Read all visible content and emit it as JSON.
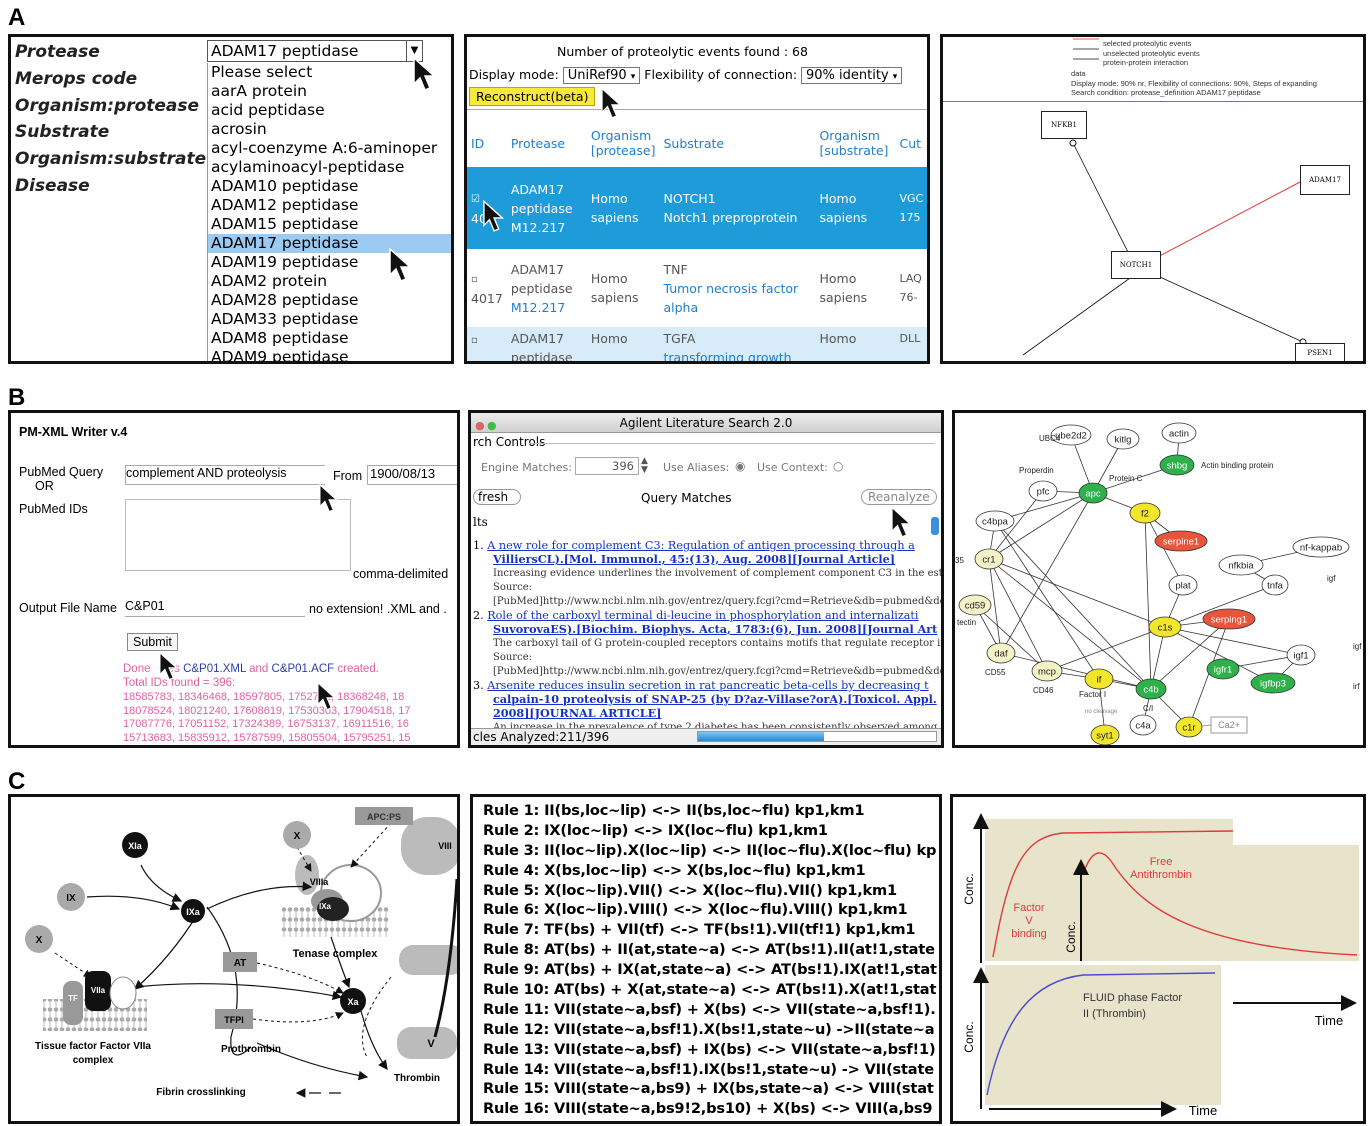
{
  "panel_labels": {
    "a": "A",
    "b": "B",
    "c": "C"
  },
  "a1": {
    "labels": [
      "Protease",
      "Merops code",
      "Organism:protease",
      "Substrate",
      "Organism:substrate",
      "Disease"
    ],
    "selected": "ADAM17 peptidase",
    "options": [
      "Please select",
      "aarA protein",
      "acid peptidase",
      "acrosin",
      "acyl-coenzyme A:6-aminoper",
      "acylaminoacyl-peptidase",
      "ADAM10 peptidase",
      "ADAM12 peptidase",
      "ADAM15 peptidase",
      "ADAM17 peptidase",
      "ADAM19 peptidase",
      "ADAM2 protein",
      "ADAM28 peptidase",
      "ADAM33 peptidase",
      "ADAM8 peptidase",
      "ADAM9 peptidase"
    ],
    "highlight_index": 9
  },
  "a2": {
    "events_found": "Number of proteolytic events found : 68",
    "display_mode_label": "Display mode:",
    "display_mode_value": "UniRef90",
    "flex_label": "Flexibility of connection:",
    "flex_value": "90% identity",
    "reconstruct_button": "Reconstruct(beta)",
    "headers": {
      "id": "ID",
      "protease": "Protease",
      "org_protease": "Organism [protease]",
      "substrate": "Substrate",
      "org_substrate": "Organism [substrate]",
      "cut": "Cut"
    },
    "rows": [
      {
        "id": "40",
        "protease": "ADAM17 peptidase",
        "merops": "M12.217",
        "org_p": "Homo sapiens",
        "sub": "NOTCH1",
        "sub_desc": "Notch1 preproprotein",
        "org_s": "Homo sapiens",
        "cut": "VGC 175"
      },
      {
        "id": "4017",
        "protease": "ADAM17 peptidase",
        "merops": "M12.217",
        "org_p": "Homo sapiens",
        "sub": "TNF",
        "sub_desc": "Tumor necrosis factor alpha",
        "org_s": "Homo sapiens",
        "cut": "LAQ 76-"
      },
      {
        "id": "",
        "protease": "ADAM17 peptidase",
        "merops": "",
        "org_p": "Homo",
        "sub": "TGFA",
        "sub_desc": "transforming growth",
        "org_s": "Homo",
        "cut": "DLL"
      }
    ]
  },
  "a3": {
    "legend": [
      "selected proteolytic events",
      "unselected proteolytic events",
      "protein-protein interaction",
      "data",
      "Display mode: 90% nr, Flexibility of connections: 90%, Steps of expanding",
      "Search condition: protease_definition ADAM17 peptidase"
    ],
    "nodes": {
      "nfkb1": "NFKB1",
      "adam17": "ADAM17",
      "notch1": "NOTCH1",
      "psen1": "PSEN1"
    }
  },
  "b1": {
    "title": "PM-XML Writer v.4",
    "query_label": "PubMed Query",
    "or_label": "OR",
    "ids_label": "PubMed IDs",
    "query_value": "complement AND proteolysis",
    "from_label": "From",
    "from_value": "1900/08/13",
    "comma_note": "comma-delimited",
    "output_label": "Output File Name",
    "output_value": "C&P01",
    "ext_note": "no extension! .XML and .",
    "submit": "Submit",
    "done_prefix": "Done",
    "done_fragment": "es",
    "file1": "C&P01.XML",
    "and_word": "and",
    "file2": "C&P01.ACF",
    "created": "created.",
    "total": "Total IDs found = 396:",
    "id_lines": [
      "18585783, 18346468, 18597805, 1752712, 18368248, 18",
      "18078524, 18021240, 17608619, 17530303, 17904518, 17",
      "17087776, 17051152, 17324389, 16753137, 16911516, 16",
      "15713683, 15835912, 15787599, 15805504, 15795251, 15"
    ]
  },
  "b2": {
    "title": "Agilent Literature Search 2.0",
    "controls": "rch Controls",
    "engine_label": "Engine Matches:",
    "engine_value": "396",
    "aliases": "Use Aliases:",
    "context": "Use Context:",
    "refresh": "fresh",
    "query_matches": "Query Matches",
    "reanalyze": "Reanalyze",
    "results_label": "lts",
    "results": [
      {
        "num": "1.",
        "title": "A new role for complement C3: Regulation of antigen processing through a",
        "cite": "VilliersCL).[Mol. Immunol., 45:(13), Aug. 2008][Journal Article]",
        "abstract": "Increasing evidence underlines the involvement of complement component C3 in the establi",
        "src": "Source:",
        "url": "[PubMed]http://www.ncbi.nlm.nih.gov/entrez/query.fcgi?cmd=Retrieve&db=pubmed&dop"
      },
      {
        "num": "2.",
        "title": "Role of the carboxyl terminal di-leucine in phosphorylation and internalizati",
        "cite": "SuvorovaES).[Biochim. Biophys. Acta, 1783:(6), Jun. 2008][Journal Art",
        "abstract": "The carboxyl tail of G protein-coupled receptors contains motifs that regulate receptor interc",
        "src": "Source:",
        "url": "[PubMed]http://www.ncbi.nlm.nih.gov/entrez/query.fcgi?cmd=Retrieve&db=pubmed&dop"
      },
      {
        "num": "3.",
        "title": "Arsenite reduces insulin secretion in rat pancreatic beta-cells by decreasing t",
        "cite": "calpain-10 proteolysis of SNAP-25 (by D?az-Villase?orA).[Toxicol. Appl.",
        "cite2": "2008][JOURNAL ARTICLE]",
        "abstract": "An increase in the prevalence of type 2 diabetes has been consistently observed among resid"
      }
    ],
    "status": "cles Analyzed:211/396",
    "progress": 0.53
  },
  "b3": {
    "nodes": {
      "ube2d2": "ube2d2",
      "ubc4": "UBC4",
      "kitlg": "kitlg",
      "actin": "actin",
      "shbg": "shbg",
      "actin_bp": "Actin binding protein",
      "properdin": "Properdin",
      "pfc": "pfc",
      "apc": "apc",
      "proteinc": "Protein C",
      "f2": "f2",
      "c4bpa": "c4bpa",
      "cr1": "cr1",
      "serpine1": "serpine1",
      "nfkappab": "nf-kappab",
      "nfkbia": "nfkbia",
      "tnfa": "tnfa",
      "igf": "igf",
      "cd59": "cd59",
      "tectin": "tectin",
      "plat": "plat",
      "serping1": "serping1",
      "c1s": "c1s",
      "daf": "daf",
      "cd55": "CD55",
      "mcp": "mcp",
      "cd46": "CD46",
      "if": "if",
      "factori": "Factor I",
      "c4b": "c4b",
      "ci": "C/I",
      "igfr1": "igfr1",
      "igf1": "igf1",
      "igfbp3": "igfbp3",
      "igf2": "igf",
      "irf": "irf",
      "nocleavage": "no cleavage",
      "syt1": "syt1",
      "c4a": "c4a",
      "c1r": "c1r",
      "ca2": "Ca2+",
      "n35": "35"
    },
    "colors": {
      "green": "#2eb04a",
      "yellow": "#f2e62d",
      "red": "#e8553a",
      "pale": "#f3f1c6"
    }
  },
  "c1": {
    "apcps": "APC:PS",
    "xia": "XIa",
    "ix": "IX",
    "ixa": "IXa",
    "x1": "X",
    "x2": "X",
    "viii": "VIII",
    "viiia": "VIIIa",
    "ixa2": "IXa",
    "tenase": "Tenase complex",
    "at": "AT",
    "xa": "Xa",
    "tf": "TF",
    "viia": "VIIa",
    "tfpi": "TFPI",
    "v": "V",
    "tissue": "Tissue factor Factor VIIa",
    "complex": "complex",
    "prothrombin": "Prothrombin",
    "thrombin": "Thrombin",
    "fibrin": "Fibrin crosslinking"
  },
  "c2": {
    "rules": [
      "Rule 1: II(bs,loc~lip) <-> II(bs,loc~flu) kp1,km1",
      "Rule 2: IX(loc~lip) <-> IX(loc~flu) kp1,km1",
      "Rule 3: II(loc~lip).X(loc~lip) <-> II(loc~flu).X(loc~flu) kp",
      "Rule 4: X(bs,loc~lip) <-> X(bs,loc~flu) kp1,km1",
      "Rule 5: X(loc~lip).VII() <-> X(loc~flu).VII() kp1,km1",
      "Rule 6: X(loc~lip).VIII() <-> X(loc~flu).VIII() kp1,km1",
      "Rule 7: TF(bs) + VII(tf) <-> TF(bs!1).VII(tf!1) kp1,km1",
      "Rule 8: AT(bs) + II(at,state~a) <-> AT(bs!1).II(at!1,state",
      "Rule 9: AT(bs) + IX(at,state~a) <-> AT(bs!1).IX(at!1,stat",
      "Rule 10: AT(bs) + X(at,state~a) <-> AT(bs!1).X(at!1,stat",
      "Rule 11: VII(state~a,bsf) + X(bs) <-> VII(state~a,bsf!1).",
      "Rule 12: VII(state~a,bsf!1).X(bs!1,state~u) ->II(state~a",
      "Rule 13: VII(state~a,bsf) + IX(bs) <-> VII(state~a,bsf!1)",
      "Rule 14: VII(state~a,bsf!1).IX(bs!1,state~u) -> VII(state",
      "Rule 15: VIII(state~a,bs9) + IX(bs,state~a) <-> VIII(stat",
      "Rule 16: VIII(state~a,bs9!2,bs10) + X(bs) <-> VIII(a,bs9"
    ]
  },
  "c3": {
    "conc": "Conc.",
    "time": "Time",
    "free": "Free",
    "antithrombin": "Antithrombin",
    "factor": "Factor",
    "v": "V",
    "binding": "binding",
    "fluid1": "FLUID phase Factor",
    "fluid2": "II (Thrombin)"
  }
}
